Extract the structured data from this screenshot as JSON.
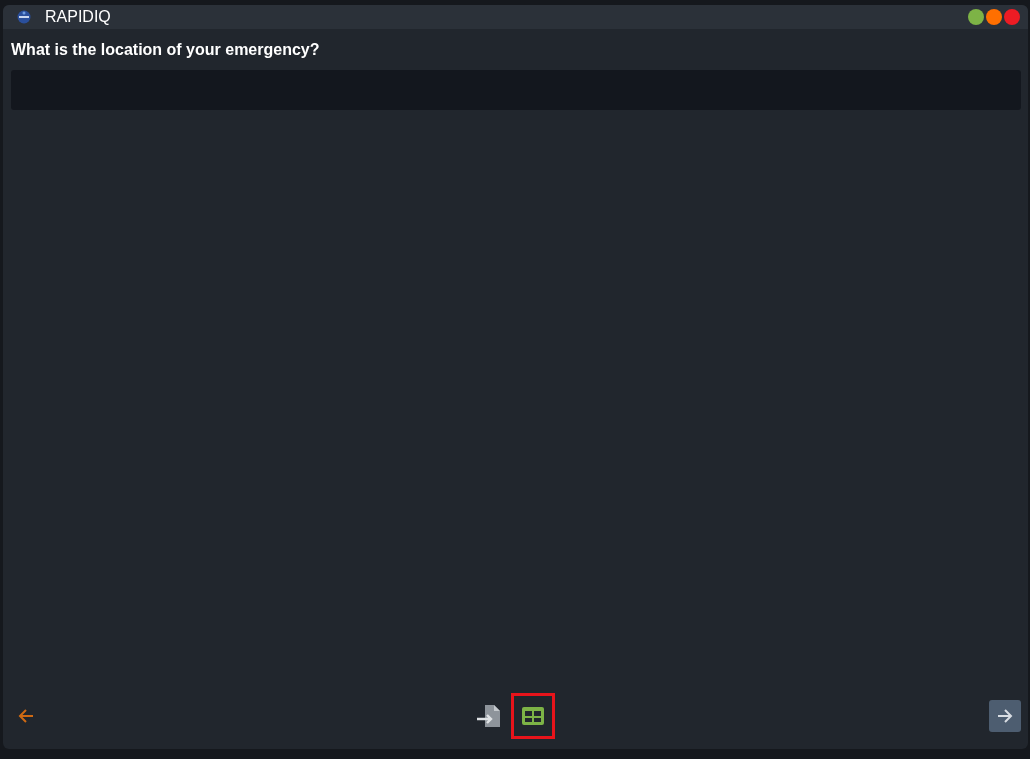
{
  "window": {
    "title": "RAPIDIQ"
  },
  "question": {
    "text": "What is the location of your emergency?"
  },
  "toolbar": [
    {
      "kind": "import",
      "selected": false
    },
    {
      "kind": "table",
      "selected": true
    }
  ]
}
